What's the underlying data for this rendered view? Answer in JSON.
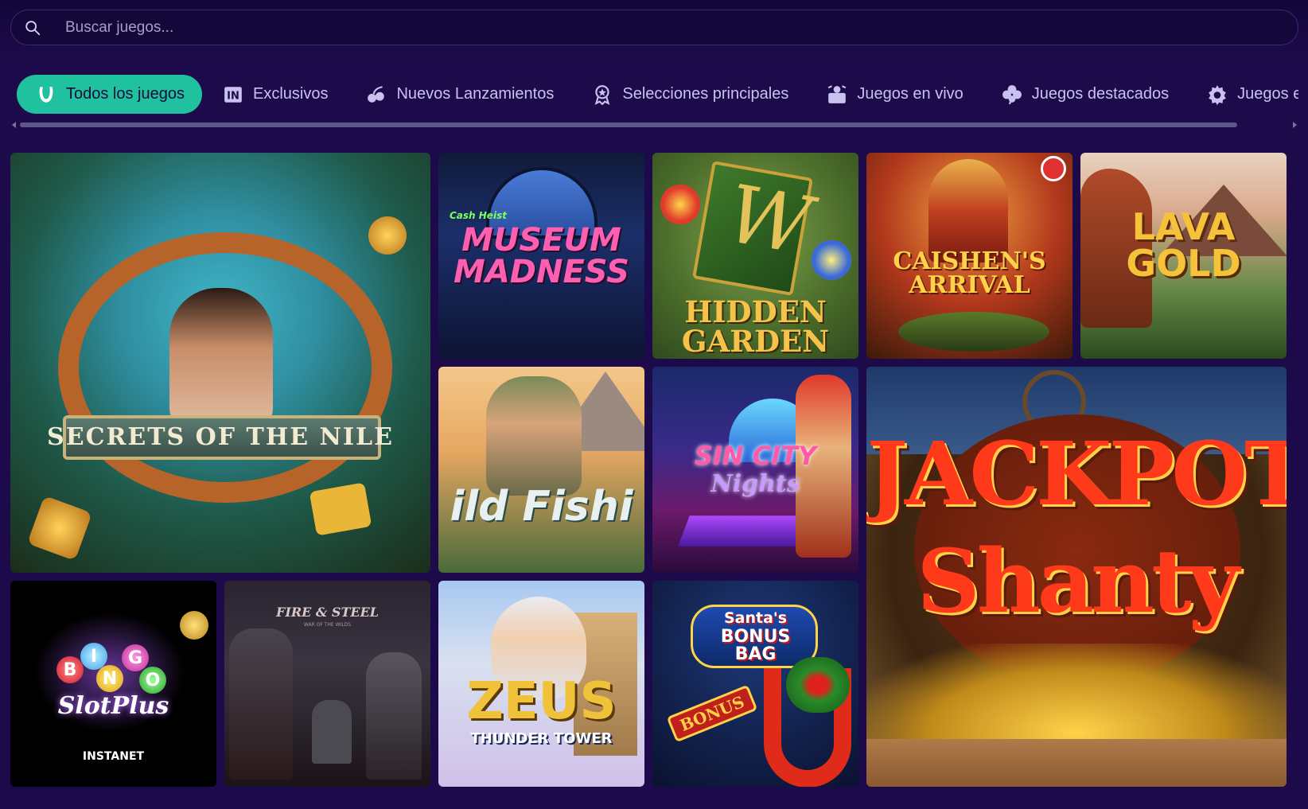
{
  "search": {
    "placeholder": "Buscar juegos..."
  },
  "tabs": [
    {
      "label": "Todos los juegos",
      "icon": "horseshoe-icon",
      "active": true
    },
    {
      "label": "Exclusivos",
      "icon": "exclusive-icon",
      "active": false
    },
    {
      "label": "Nuevos Lanzamientos",
      "icon": "cherries-icon",
      "active": false
    },
    {
      "label": "Selecciones principales",
      "icon": "award-icon",
      "active": false
    },
    {
      "label": "Juegos en vivo",
      "icon": "live-dealer-icon",
      "active": false
    },
    {
      "label": "Juegos destacados",
      "icon": "clover-icon",
      "active": false
    },
    {
      "label": "Juegos espec",
      "icon": "gear-icon",
      "active": false
    }
  ],
  "colors": {
    "background": "#1d0a4a",
    "active_tab": "#1fc19e",
    "tab_text": "#c9c2f0"
  },
  "games": {
    "nile": {
      "title": "Secrets of the Nile"
    },
    "museum": {
      "title": "Museum Madness",
      "sub": "Cash Heist"
    },
    "garden": {
      "title": "Hidden Garden"
    },
    "caishen": {
      "title": "Caishen's Arrival"
    },
    "lava": {
      "title": "Lava Gold"
    },
    "fish": {
      "title": "ild Fishi"
    },
    "sin": {
      "title": "Sin City",
      "title2": "Nights"
    },
    "shanty": {
      "title": "Jackpot",
      "title2": "Shanty"
    },
    "bingo": {
      "balls": [
        "B",
        "I",
        "N",
        "G",
        "O"
      ],
      "title": "SlotPlus",
      "provider": "INSTANET"
    },
    "fire": {
      "title": "Fire & Steel",
      "sub": "WAR OF THE WILDS"
    },
    "zeus": {
      "title": "Zeus",
      "sub": "Thunder Tower"
    },
    "santa": {
      "title": "Santa's",
      "sub1": "BONUS",
      "sub2": "BAG",
      "bonus": "BONUS"
    }
  }
}
